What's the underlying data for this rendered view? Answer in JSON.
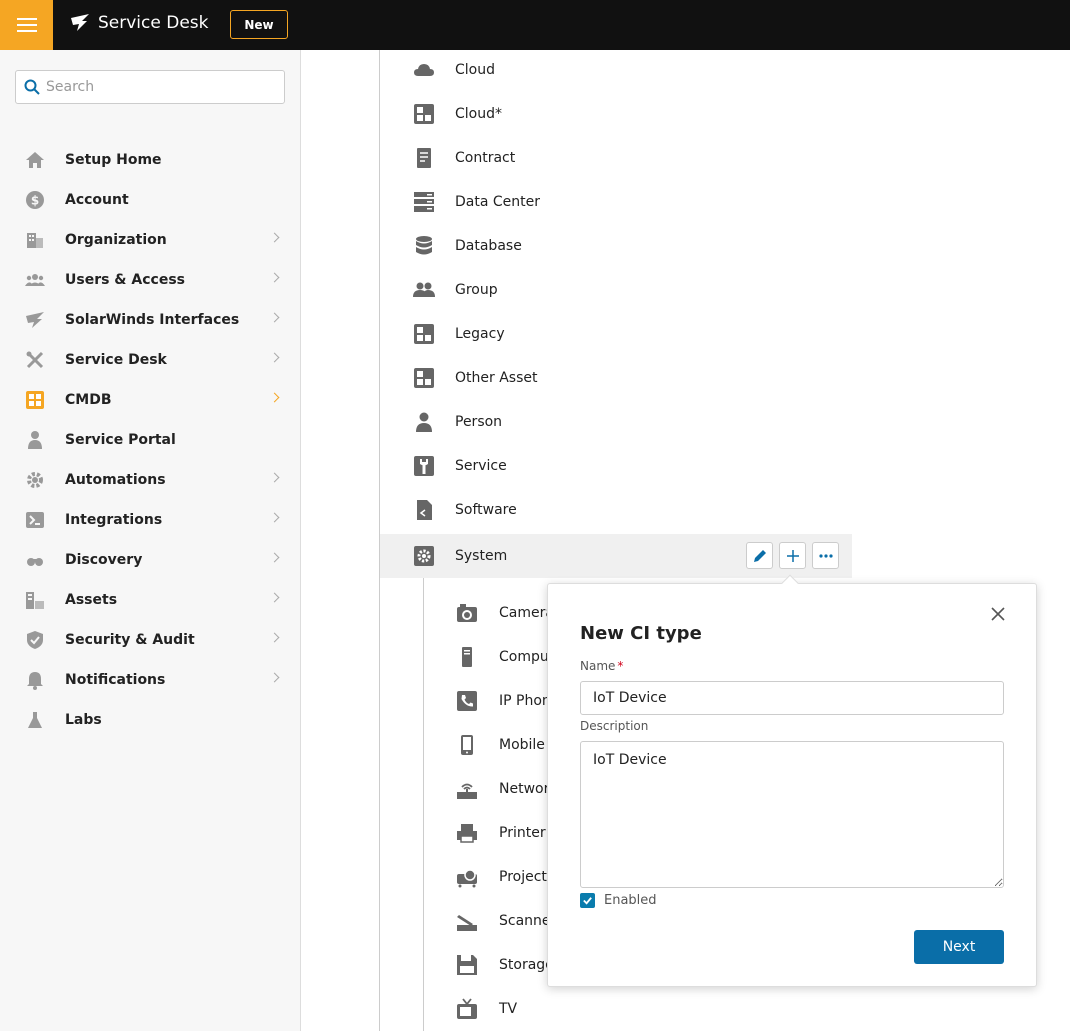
{
  "header": {
    "app_name": "Service Desk",
    "new_label": "New"
  },
  "sidebar": {
    "search_placeholder": "Search",
    "items": [
      {
        "label": "Setup Home"
      },
      {
        "label": "Account"
      },
      {
        "label": "Organization"
      },
      {
        "label": "Users & Access"
      },
      {
        "label": "SolarWinds Interfaces"
      },
      {
        "label": "Service Desk"
      },
      {
        "label": "CMDB"
      },
      {
        "label": "Service Portal"
      },
      {
        "label": "Automations"
      },
      {
        "label": "Integrations"
      },
      {
        "label": "Discovery"
      },
      {
        "label": "Assets"
      },
      {
        "label": "Security & Audit"
      },
      {
        "label": "Notifications"
      },
      {
        "label": "Labs"
      }
    ]
  },
  "ci_types": [
    {
      "label": "Cloud"
    },
    {
      "label": "Cloud*"
    },
    {
      "label": "Contract"
    },
    {
      "label": "Data Center"
    },
    {
      "label": "Database"
    },
    {
      "label": "Group"
    },
    {
      "label": "Legacy"
    },
    {
      "label": "Other Asset"
    },
    {
      "label": "Person"
    },
    {
      "label": "Service"
    },
    {
      "label": "Software"
    },
    {
      "label": "System"
    }
  ],
  "system_children": [
    {
      "label": "Camera"
    },
    {
      "label": "Compu"
    },
    {
      "label": "IP Phon"
    },
    {
      "label": "Mobile"
    },
    {
      "label": "Networ"
    },
    {
      "label": "Printer"
    },
    {
      "label": "Projecto"
    },
    {
      "label": "Scanne"
    },
    {
      "label": "Storage"
    },
    {
      "label": "TV"
    }
  ],
  "dialog": {
    "title": "New CI type",
    "name_label": "Name",
    "required_mark": "*",
    "name_value": "IoT Device",
    "description_label": "Description",
    "description_value": "IoT Device",
    "enabled_label": "Enabled",
    "next_label": "Next"
  },
  "colors": {
    "accent": "#f5a623",
    "primary": "#0a6ea8",
    "topbar": "#111111"
  }
}
